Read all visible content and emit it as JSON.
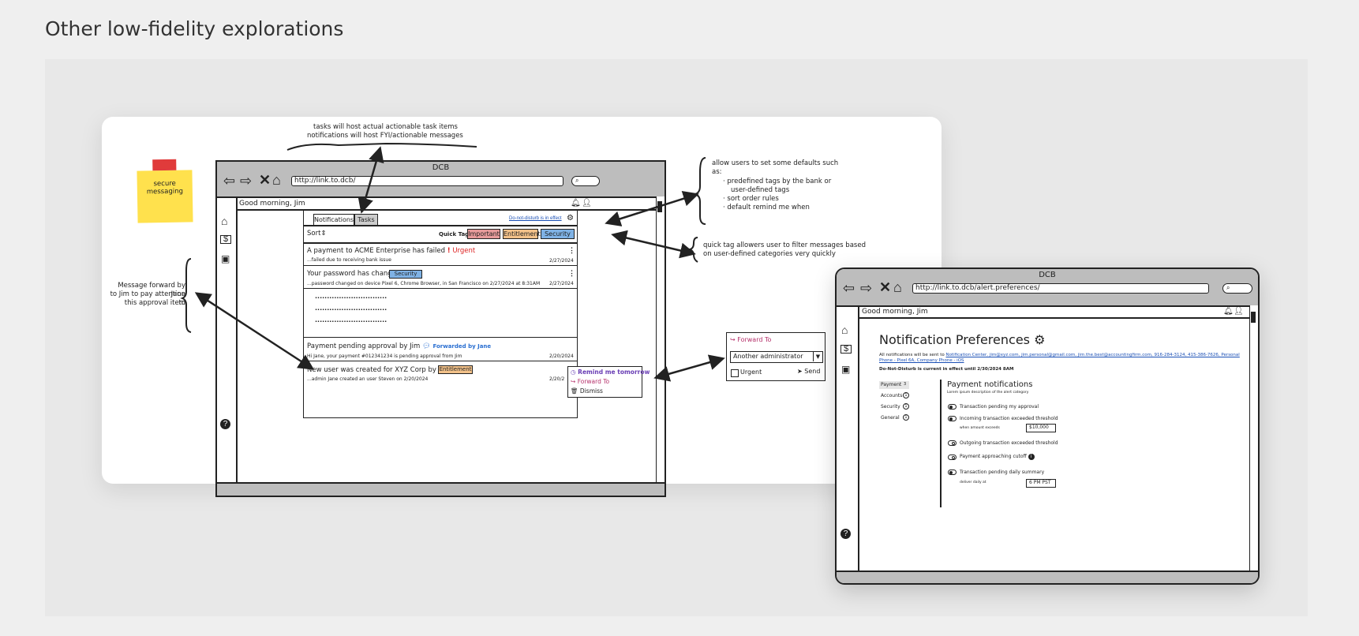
{
  "page_title": "Other low-fidelity explorations",
  "sticky": {
    "label": "secure messaging"
  },
  "annotations": {
    "tasks_note_1": "tasks will host actual actionable task items",
    "tasks_note_2": "notifications will host FYI/actionable messages",
    "defaults_title_1": "allow users to set some defaults such",
    "defaults_title_2": "as:",
    "defaults_items": [
      "predefined tags by the bank or",
      "user-defined tags",
      "sort order rules",
      "default remind me when"
    ],
    "quicktag_note_1": "quick tag allowers user to filter messages based",
    "quicktag_note_2": "on user-defined categories very quickly",
    "forward_note_1": "Message forward by Jane",
    "forward_note_2": "to Jim to pay attention to",
    "forward_note_3": "this approval item"
  },
  "left_browser": {
    "window_title": "DCB",
    "url": "http://link.to.dcb/",
    "greeting": "Good morning, Jim",
    "tabs": [
      "Notifications",
      "Tasks"
    ],
    "dnd_link": "Do-not-disturb is in effect",
    "sort_label": "Sort",
    "quick_tag_label": "Quick Tag:",
    "quick_tags": [
      "Important",
      "Entitlement",
      "Security"
    ],
    "messages": {
      "m1_title": "A payment to ACME Enterprise has failed",
      "m1_flag": "Urgent",
      "m1_sub": "...failed due to receiving bank issue",
      "m1_date": "2/27/2024",
      "m2_title": "Your password has changed",
      "m2_tag": "Security",
      "m2_sub": "...password changed on device Pixel 6, Chrome Browser, in San Francisco on 2/27/2024 at 8:31AM",
      "m2_date": "2/27/2024",
      "dots": "..............................",
      "m3_title": "Payment pending approval by Jim",
      "m3_fwd": "Forwarded by Jane",
      "m3_sub": "Hi Jane, your payment #012341234 is pending approval from Jim",
      "m3_date": "2/20/2024",
      "m4_title": "New user was created for XYZ Corp by Jane",
      "m4_tag": "Entitlement",
      "m4_sub": "...admin Jane created an user Steven on 2/20/2024",
      "m4_date": "2/20/2"
    },
    "context_menu": [
      "Remind me tomorrow",
      "Forward To",
      "Dismiss"
    ]
  },
  "forward_popup": {
    "title": "Forward To",
    "select_value": "Another administrator",
    "urgent_label": "Urgent",
    "send_label": "Send"
  },
  "right_browser": {
    "window_title": "DCB",
    "url": "http://link.to.dcb/alert.preferences/",
    "greeting": "Good morning, Jim",
    "heading": "Notification Preferences",
    "sent_to_prefix": "All notifications will be sent to",
    "sent_to_links": "Notification Center, jim@xyz.com, jim.personal@gmail.com, jim.the.best@accountingfirm.com, 916-284-3124, 415-386-7626, Personal Phone - Pixel 6A, Company Phone - iOS",
    "dnd_status": "Do-Not-Disturb is current in effect until 2/30/2024 8AM",
    "categories": [
      {
        "label": "Payment",
        "count": "3"
      },
      {
        "label": "Accounts",
        "count": "1"
      },
      {
        "label": "Security",
        "count": "1"
      },
      {
        "label": "General",
        "count": "1"
      }
    ],
    "section_title": "Payment notifications",
    "section_desc": "Lorem ipsum description of the alert category",
    "settings": {
      "s1": "Transaction pending my approval",
      "s2": "Incoming transaction exceeded threshold",
      "s2_sub_label": "when amount exceeds",
      "s2_value": "$10,000",
      "s3": "Outgoing transaction exceeded threshold",
      "s4": "Payment approaching cutoff",
      "s5": "Transaction pending daily summary",
      "s5_sub_label": "deliver daily at",
      "s5_value": "6 PM PST"
    }
  }
}
